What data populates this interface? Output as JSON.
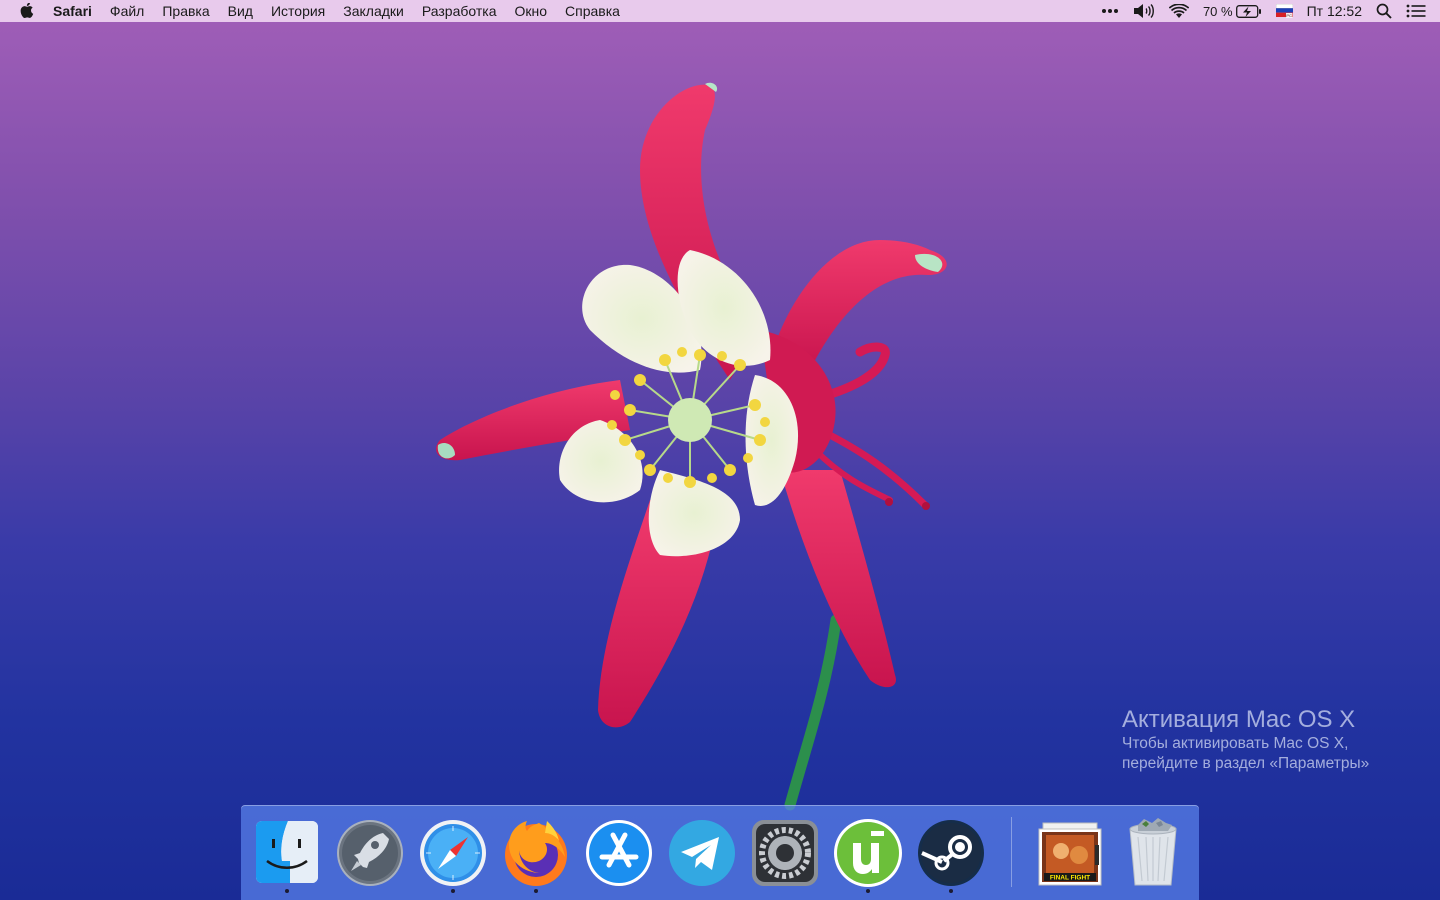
{
  "menubar": {
    "app_name": "Safari",
    "items": [
      "Файл",
      "Правка",
      "Вид",
      "История",
      "Закладки",
      "Разработка",
      "Окно",
      "Справка"
    ],
    "status": {
      "battery_percent": "70 %",
      "clock": "Пт 12:52",
      "icons": [
        "more-dots-icon",
        "volume-icon",
        "wifi-icon",
        "battery-charging-icon",
        "russian-flag-input-icon",
        "spotlight-search-icon",
        "notification-center-icon"
      ]
    }
  },
  "activation": {
    "title": "Активация Mac OS X",
    "line1": "Чтобы активировать Mac OS X,",
    "line2": "перейдите в раздел «Параметры»"
  },
  "dock": {
    "apps": [
      {
        "name": "Finder",
        "icon": "finder-icon",
        "running": true
      },
      {
        "name": "Launchpad",
        "icon": "launchpad-rocket-icon",
        "running": false
      },
      {
        "name": "Safari",
        "icon": "safari-compass-icon",
        "running": true
      },
      {
        "name": "Firefox",
        "icon": "firefox-icon",
        "running": true
      },
      {
        "name": "App Store",
        "icon": "app-store-icon",
        "running": false
      },
      {
        "name": "Telegram",
        "icon": "telegram-icon",
        "running": false
      },
      {
        "name": "System Preferences",
        "icon": "system-preferences-gear-icon",
        "running": false
      },
      {
        "name": "uTorrent",
        "icon": "utorrent-icon",
        "running": true
      },
      {
        "name": "Steam",
        "icon": "steam-icon",
        "running": true
      }
    ],
    "stack": {
      "icon": "downloads-stack-icon",
      "label": "FINAL FIGHT"
    },
    "trash": {
      "icon": "trash-full-icon"
    }
  },
  "colors": {
    "menubar_bg": "#eed4f0",
    "dock_bg": "#5a82eb",
    "wallpaper_top": "#a25fb8",
    "wallpaper_bottom": "#1a2b96",
    "petal_red": "#e1245e",
    "petal_white": "#f4f1e6",
    "stamen_yellow": "#f2d640"
  }
}
